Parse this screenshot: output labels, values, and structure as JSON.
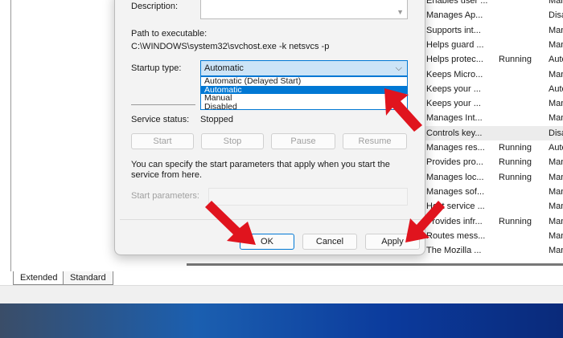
{
  "dialog": {
    "description_label": "Description:",
    "path_label": "Path to executable:",
    "path_value": "C:\\WINDOWS\\system32\\svchost.exe -k netsvcs -p",
    "startup_label": "Startup type:",
    "startup_value": "Automatic",
    "startup_options": [
      "Automatic (Delayed Start)",
      "Automatic",
      "Manual",
      "Disabled"
    ],
    "status_label": "Service status:",
    "status_value": "Stopped",
    "buttons": {
      "start": "Start",
      "stop": "Stop",
      "pause": "Pause",
      "resume": "Resume"
    },
    "hint": "You can specify the start parameters that apply when you start the service from here.",
    "params_label": "Start parameters:",
    "ok": "OK",
    "cancel": "Cancel",
    "apply": "Apply"
  },
  "services": [
    {
      "desc": "Enables user ...",
      "status": "",
      "startup": "Manu"
    },
    {
      "desc": "Manages Ap...",
      "status": "",
      "startup": "Disab"
    },
    {
      "desc": "Supports int...",
      "status": "",
      "startup": "Manu"
    },
    {
      "desc": "Helps guard ...",
      "status": "",
      "startup": "Manu"
    },
    {
      "desc": "Helps protec...",
      "status": "Running",
      "startup": "Auto"
    },
    {
      "desc": "Keeps Micro...",
      "status": "",
      "startup": "Manu"
    },
    {
      "desc": "Keeps your ...",
      "status": "",
      "startup": "Auto"
    },
    {
      "desc": "Keeps your ...",
      "status": "",
      "startup": "Manu"
    },
    {
      "desc": "Manages Int...",
      "status": "",
      "startup": "Manu"
    },
    {
      "desc": "Controls key...",
      "status": "",
      "startup": "Disab"
    },
    {
      "desc": "Manages res...",
      "status": "Running",
      "startup": "Auto"
    },
    {
      "desc": "Provides pro...",
      "status": "Running",
      "startup": "Manu"
    },
    {
      "desc": "Manages loc...",
      "status": "Running",
      "startup": "Manu"
    },
    {
      "desc": "Manages sof...",
      "status": "",
      "startup": "Manu"
    },
    {
      "desc": "Host service ...",
      "status": "",
      "startup": "Manu"
    },
    {
      "desc": "Provides infr...",
      "status": "Running",
      "startup": "Manu"
    },
    {
      "desc": "Routes mess...",
      "status": "",
      "startup": "Manu"
    },
    {
      "desc": "The Mozilla ...",
      "status": "",
      "startup": "Manu"
    }
  ],
  "tabs": [
    "Extended",
    "Standard"
  ],
  "colors": {
    "accent": "#0078d4",
    "arrow": "#e0141e"
  }
}
